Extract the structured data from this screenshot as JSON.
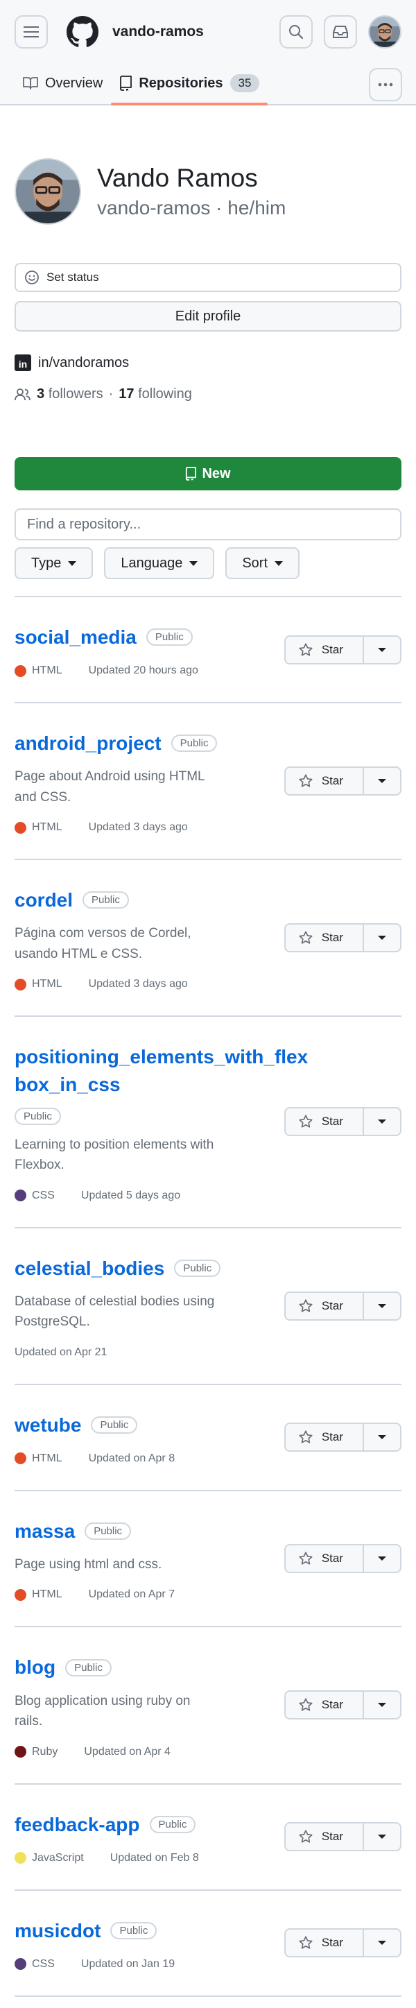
{
  "header": {
    "username": "vando-ramos"
  },
  "tabs": [
    {
      "label": "Overview"
    },
    {
      "label": "Repositories",
      "count": "35"
    }
  ],
  "profile": {
    "full_name": "Vando Ramos",
    "nickname_pronouns": "vando-ramos · he/him",
    "set_status_label": "Set status",
    "edit_profile_label": "Edit profile",
    "linkedin": "in/vandoramos",
    "followers_count": "3",
    "followers_label": "followers",
    "separator": "·",
    "following_count": "17",
    "following_label": "following"
  },
  "repo_controls": {
    "new_label": "New",
    "search_placeholder": "Find a repository...",
    "filters": [
      "Type",
      "Language",
      "Sort"
    ]
  },
  "star_label": "Star",
  "repos": [
    {
      "name": "social_media",
      "visibility": "Public",
      "description": "",
      "language": "HTML",
      "lang_color": "#e34c26",
      "updated": "Updated 20 hours ago"
    },
    {
      "name": "android_project",
      "visibility": "Public",
      "description": "Page about Android using HTML and CSS.",
      "language": "HTML",
      "lang_color": "#e34c26",
      "updated": "Updated 3 days ago"
    },
    {
      "name": "cordel",
      "visibility": "Public",
      "description": "Página com versos de Cordel, usando HTML e CSS.",
      "language": "HTML",
      "lang_color": "#e34c26",
      "updated": "Updated 3 days ago"
    },
    {
      "name": "positioning_elements_with_flexbox_in_css",
      "visibility": "Public",
      "description": "Learning to position elements with Flexbox.",
      "language": "CSS",
      "lang_color": "#563d7c",
      "updated": "Updated 5 days ago"
    },
    {
      "name": "celestial_bodies",
      "visibility": "Public",
      "description": "Database of celestial bodies using PostgreSQL.",
      "language": "",
      "lang_color": "",
      "updated": "Updated on Apr 21"
    },
    {
      "name": "wetube",
      "visibility": "Public",
      "description": "",
      "language": "HTML",
      "lang_color": "#e34c26",
      "updated": "Updated on Apr 8"
    },
    {
      "name": "massa",
      "visibility": "Public",
      "description": "Page using html and css.",
      "language": "HTML",
      "lang_color": "#e34c26",
      "updated": "Updated on Apr 7"
    },
    {
      "name": "blog",
      "visibility": "Public",
      "description": "Blog application using ruby on rails.",
      "language": "Ruby",
      "lang_color": "#701516",
      "updated": "Updated on Apr 4"
    },
    {
      "name": "feedback-app",
      "visibility": "Public",
      "description": "",
      "language": "JavaScript",
      "lang_color": "#f1e05a",
      "updated": "Updated on Feb 8"
    },
    {
      "name": "musicdot",
      "visibility": "Public",
      "description": "",
      "language": "CSS",
      "lang_color": "#563d7c",
      "updated": "Updated on Jan 19"
    }
  ],
  "colors": {
    "primary_green": "#1f883d",
    "link_blue": "#0969da",
    "tab_underline": "#fd8c73"
  }
}
